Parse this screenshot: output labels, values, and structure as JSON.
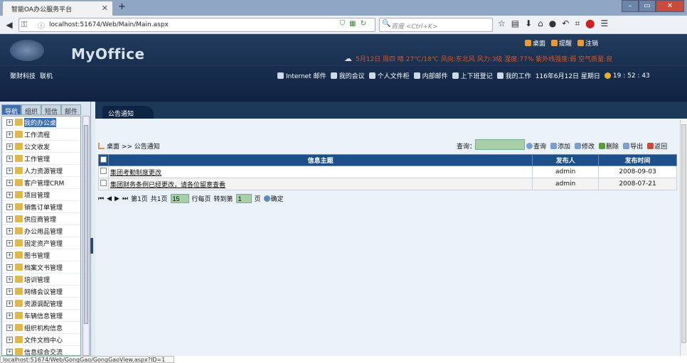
{
  "browser": {
    "tab_title": "智能OA办公服务平台",
    "url": "localhost:51674/Web/Main/Main.aspx",
    "search_placeholder": "百度 <Ctrl+K>"
  },
  "header": {
    "logo_text": "MyOffice",
    "top_links": [
      "桌面",
      "提醒",
      "注销"
    ],
    "weather": "5月12日 周四 晴 27℃/18℃ 风向:东北风 风力:3级 湿度:77% 紫外线强度:弱 空气质量:良",
    "company": "聚财科技",
    "connection": "联机",
    "nav": [
      "Internet 邮件",
      "我的会议",
      "个人文件柜",
      "内部邮件",
      "上下班登记",
      "我的工作"
    ],
    "date": "116年6月12日 星期日",
    "time": "19 : 52 : 43"
  },
  "sidebar": {
    "tabs": [
      "导航",
      "组织",
      "短信",
      "邮件"
    ],
    "items": [
      "我的办公桌",
      "工作流程",
      "公文收发",
      "工作管理",
      "人力资源管理",
      "客户管理CRM",
      "项目管理",
      "销售订单管理",
      "供应商管理",
      "办公用品管理",
      "固定资产管理",
      "图书管理",
      "档案文书管理",
      "培训管理",
      "网络会议管理",
      "资源调配管理",
      "车辆信息管理",
      "组织机构信息",
      "文件文档中心",
      "信息综合交流"
    ]
  },
  "main": {
    "tab_label": "公告通知",
    "breadcrumb": "桌面 >> 公告通知",
    "query_label": "查询：",
    "actions": [
      "查询",
      "添加",
      "修改",
      "删除",
      "导出",
      "返回"
    ],
    "columns": [
      "信息主题",
      "发布人",
      "发布时间"
    ],
    "rows": [
      {
        "subject": "集团考勤制度更改",
        "author": "admin",
        "date": "2008-09-03"
      },
      {
        "subject": "集团财务条例已经更改，请各位留意查看",
        "author": "admin",
        "date": "2008-07-21"
      }
    ],
    "pager": {
      "page_info": "第1页",
      "total_info": "共1页",
      "page_size": "15",
      "page_size_suffix": "行每页",
      "goto_label": "转到第",
      "goto_value": "1",
      "goto_suffix": "页",
      "confirm": "确定"
    }
  },
  "status_url": "localhost:51674/Web/GongGao/GongGaoView.aspx?ID=1"
}
